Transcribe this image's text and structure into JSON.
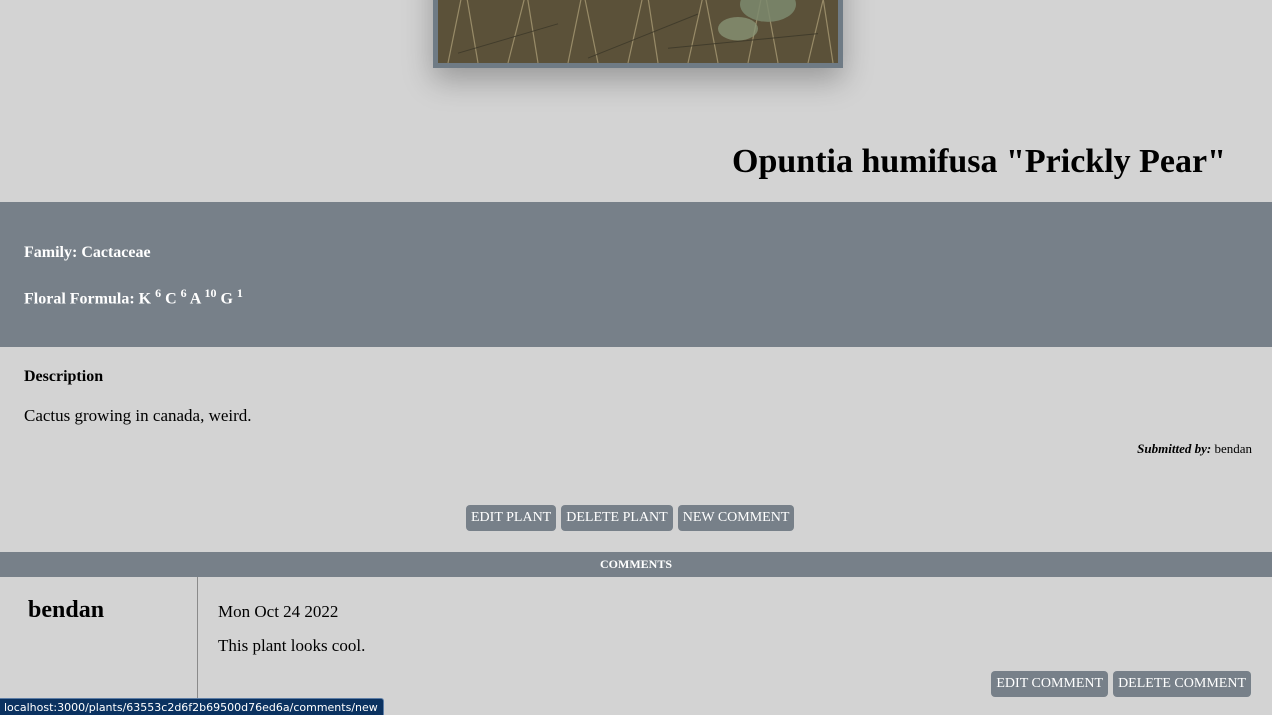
{
  "plant": {
    "title": "Opuntia humifusa \"Prickly Pear\"",
    "family_label": "Family: Cactaceae",
    "formula": {
      "label": "Floral Formula:",
      "parts": [
        {
          "letter": "K",
          "count": "6"
        },
        {
          "letter": "C",
          "count": "6"
        },
        {
          "letter": "A",
          "count": "10"
        },
        {
          "letter": "G",
          "count": "1"
        }
      ]
    },
    "description_heading": "Description",
    "description": "Cactus growing in canada, weird.",
    "submitted_label": "Submitted by:",
    "submitted_by": "bendan"
  },
  "actions": {
    "edit_plant": "EDIT PLANT",
    "delete_plant": "DELETE PLANT",
    "new_comment": "NEW COMMENT"
  },
  "comments": {
    "heading": "COMMENTS",
    "items": [
      {
        "author": "bendan",
        "date": "Mon Oct 24 2022",
        "text": "This plant looks cool.",
        "edit_label": "EDIT COMMENT",
        "delete_label": "DELETE COMMENT"
      }
    ]
  },
  "status_bar": {
    "url": "localhost:3000/plants/63553c2d6f2b69500d76ed6a/comments/new"
  },
  "colors": {
    "page_background": "#d3d3d3",
    "accent_slate": "#778089",
    "status_bar_bg": "#0b3260"
  }
}
